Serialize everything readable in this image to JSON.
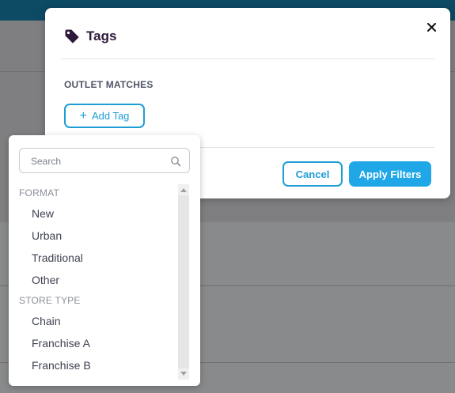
{
  "modal": {
    "title": "Tags",
    "icon": "tag-icon",
    "section_label": "OUTLET MATCHES",
    "add_tag_label": "Add Tag",
    "cancel_label": "Cancel",
    "apply_label": "Apply Filters"
  },
  "dropdown": {
    "search_placeholder": "Search",
    "groups": [
      {
        "label": "FORMAT",
        "options": [
          "New",
          "Urban",
          "Traditional",
          "Other"
        ]
      },
      {
        "label": "STORE TYPE",
        "options": [
          "Chain",
          "Franchise A",
          "Franchise B"
        ]
      }
    ]
  },
  "colors": {
    "accent": "#1fa7e8",
    "title": "#2d1a3b",
    "topbar": "#0d4a64"
  }
}
